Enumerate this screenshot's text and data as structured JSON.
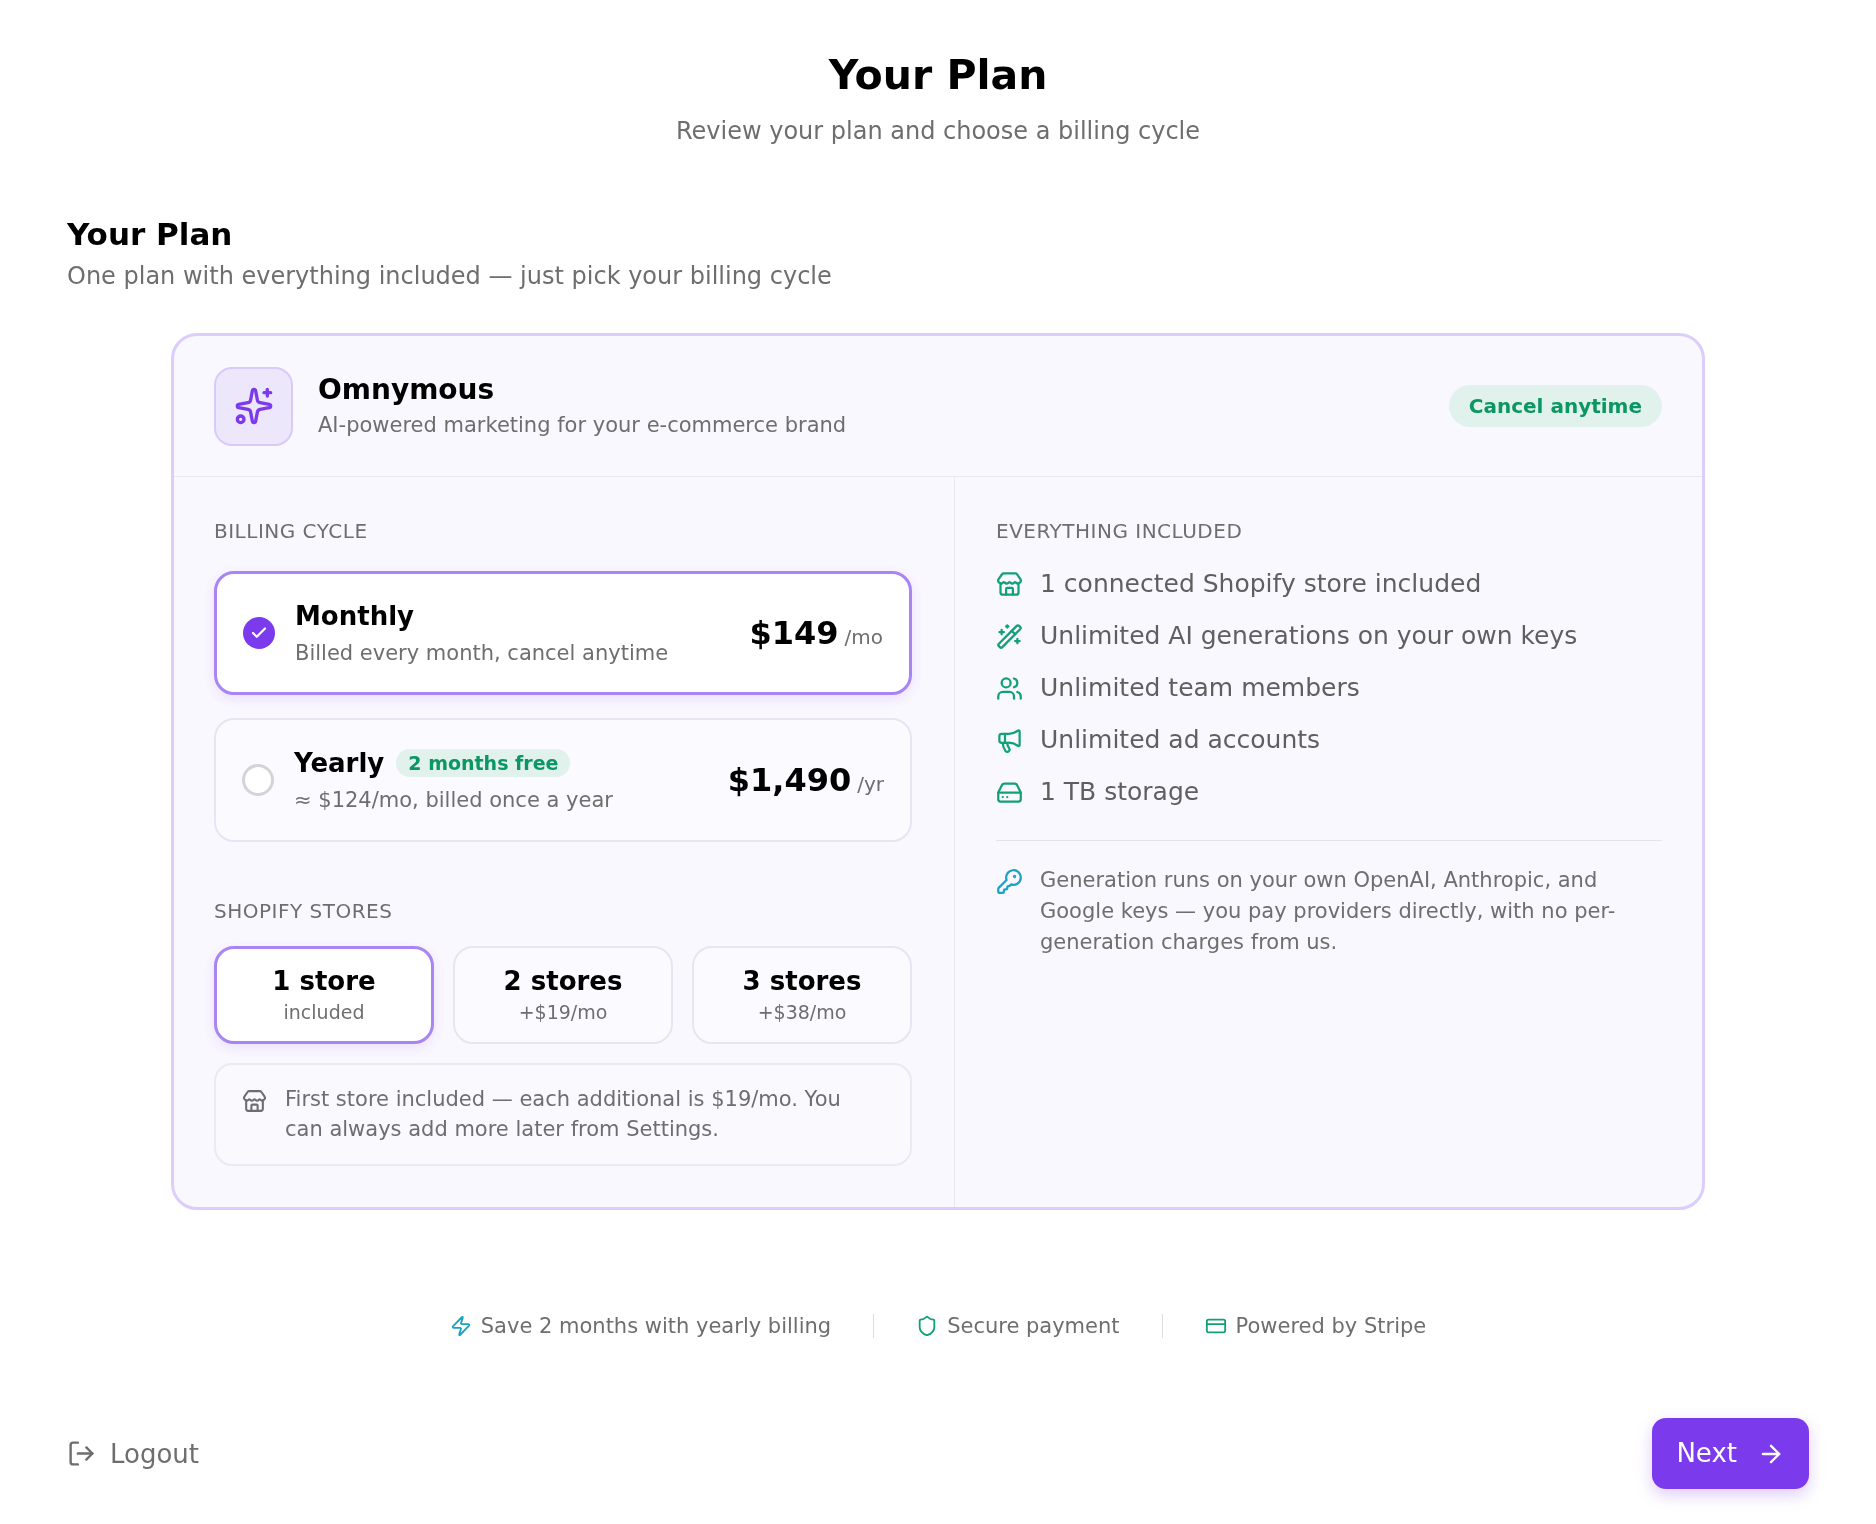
{
  "header": {
    "title": "Your Plan",
    "subtitle": "Review your plan and choose a billing cycle"
  },
  "section": {
    "title": "Your Plan",
    "subtitle": "One plan with everything included — just pick your billing cycle"
  },
  "plan_card": {
    "product": {
      "name": "Omnymous",
      "tagline": "AI-powered marketing for your e-commerce brand"
    },
    "badge": "Cancel anytime",
    "billing_cycle": {
      "label": "BILLING CYCLE",
      "options": [
        {
          "name": "Monthly",
          "description": "Billed every month, cancel anytime",
          "price": "$149",
          "unit": "/mo",
          "selected": true
        },
        {
          "name": "Yearly",
          "badge": "2 months free",
          "description": "≈ $124/mo, billed once a year",
          "price": "$1,490",
          "unit": "/yr",
          "selected": false
        }
      ]
    },
    "shopify_stores": {
      "label": "SHOPIFY STORES",
      "options": [
        {
          "count": "1 store",
          "price": "included",
          "selected": true
        },
        {
          "count": "2 stores",
          "price": "+$19/mo",
          "selected": false
        },
        {
          "count": "3 stores",
          "price": "+$38/mo",
          "selected": false
        }
      ],
      "note": "First store included — each additional is $19/mo. You can always add more later from Settings."
    },
    "included": {
      "label": "EVERYTHING INCLUDED",
      "features": [
        "1 connected Shopify store included",
        "Unlimited AI generations on your own keys",
        "Unlimited team members",
        "Unlimited ad accounts",
        "1 TB storage"
      ],
      "note": "Generation runs on your own OpenAI, Anthropic, and Google keys — you pay providers directly, with no per-generation charges from us."
    }
  },
  "trust_badges": [
    "Save 2 months with yearly billing",
    "Secure payment",
    "Powered by Stripe"
  ],
  "footer": {
    "logout": "Logout",
    "next": "Next"
  }
}
